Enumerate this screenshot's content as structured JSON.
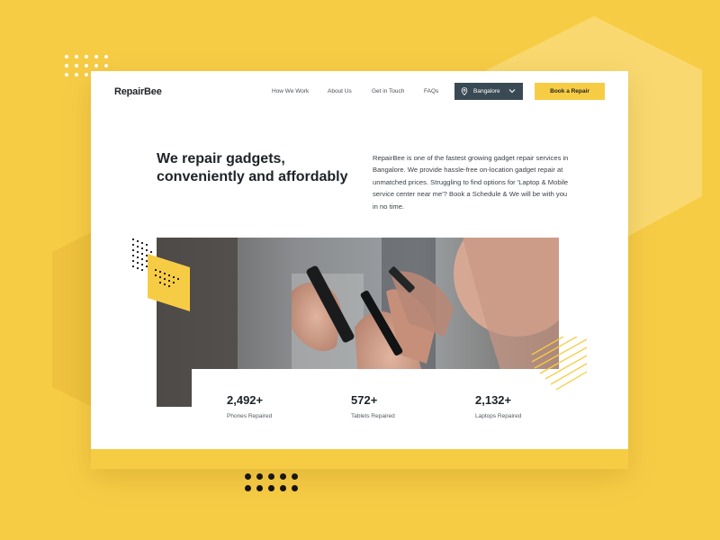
{
  "brand": {
    "name": "RepairBee"
  },
  "nav": {
    "links": [
      "How We Work",
      "About Us",
      "Get in Touch",
      "FAQs"
    ],
    "location": "Bangalore",
    "cta": "Book a Repair"
  },
  "hero": {
    "headline": "We repair gadgets, conveniently and affordably",
    "description": "RepairBee is one of the fastest growing gadget repair services in Bangalore. We provide hassle-free on-location gadget repair at unmatched prices. Struggling to find options for 'Laptop & Mobile service center near me'? Book a Schedule & We will be with you in no time."
  },
  "stats": [
    {
      "value": "2,492+",
      "label": "Phones Repaired"
    },
    {
      "value": "572+",
      "label": "Tablets Repaired"
    },
    {
      "value": "2,132+",
      "label": "Laptops Repaired"
    }
  ],
  "colors": {
    "accent": "#f7cc45",
    "dark": "#1f2328",
    "location_bg": "#3a4a54"
  },
  "icons": {
    "location": "map-pin-icon",
    "dropdown": "chevron-down-icon"
  }
}
